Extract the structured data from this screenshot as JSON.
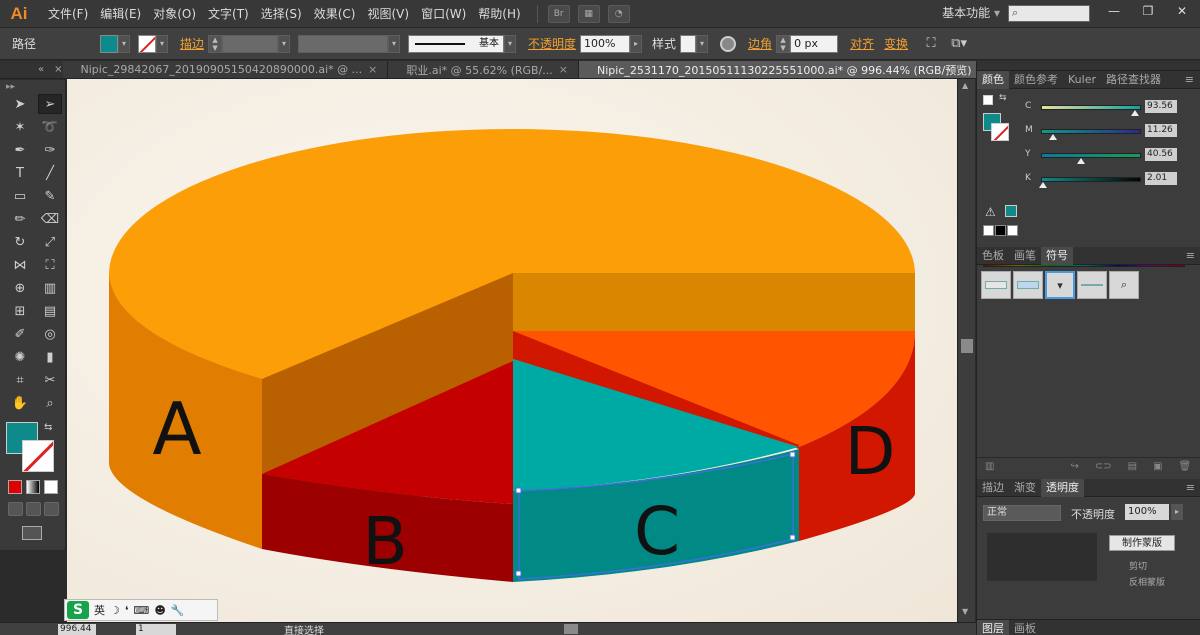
{
  "app": {
    "logo": "Ai",
    "menu": [
      "文件(F)",
      "编辑(E)",
      "对象(O)",
      "文字(T)",
      "选择(S)",
      "效果(C)",
      "视图(V)",
      "窗口(W)",
      "帮助(H)"
    ],
    "bridge_label": "Br",
    "workspace": "基本功能",
    "window_controls": [
      "—",
      "❐",
      "✕"
    ]
  },
  "control_bar": {
    "object_type": "路径",
    "stroke_label": "描边",
    "stroke_style": "基本",
    "opacity_label": "不透明度",
    "opacity_value": "100%",
    "style_label": "样式",
    "corner_label": "边角",
    "corner_value": "0 px",
    "align_label": "对齐",
    "transform_label": "变换",
    "fill_color": "#0e8a8a"
  },
  "tabs": [
    {
      "label": "Nipic_29842067_20190905150420890000.ai* @ ...",
      "active": false
    },
    {
      "label": "职业.ai* @ 55.62% (RGB/...",
      "active": false
    },
    {
      "label": "Nipic_2531170_20150511130225551000.ai* @ 996.44% (RGB/预览)",
      "active": true
    }
  ],
  "canvas": {
    "slice_labels": {
      "a": "A",
      "b": "B",
      "c": "C",
      "d": "D"
    },
    "colors": {
      "top_orange": "#fb9e07",
      "side_orange": "#e17d00",
      "inner_orange_dark": "#b96000",
      "inner_orange_mid": "#d98700",
      "red_top": "#c50000",
      "red_side": "#9c0000",
      "teal_top": "#00aaa4",
      "teal_side": "#008985",
      "d_top": "#ff5500",
      "d_side": "#d21700",
      "selection": "#3e6fd8"
    }
  },
  "status": {
    "zoom": "996.44",
    "page": "1",
    "tool_name": "直接选择"
  },
  "ime": {
    "logo": "S",
    "lang": "英"
  },
  "color_panel": {
    "tabs": [
      "颜色",
      "颜色参考",
      "Kuler",
      "路径查找器"
    ],
    "channels": [
      {
        "label": "C",
        "value": "93.56"
      },
      {
        "label": "M",
        "value": "11.26"
      },
      {
        "label": "Y",
        "value": "40.56"
      },
      {
        "label": "K",
        "value": "2.01"
      }
    ]
  },
  "symbols_panel": {
    "tabs": [
      "色板",
      "画笔",
      "符号"
    ]
  },
  "transparency_panel": {
    "tabs": [
      "描边",
      "渐变",
      "透明度"
    ],
    "mode": "正常",
    "opacity_label": "不透明度",
    "opacity_value": "100%",
    "make_mask": "制作蒙版",
    "clip": "剪切",
    "invert": "反相蒙版"
  },
  "bottom_tabs": [
    "图层",
    "画板"
  ]
}
